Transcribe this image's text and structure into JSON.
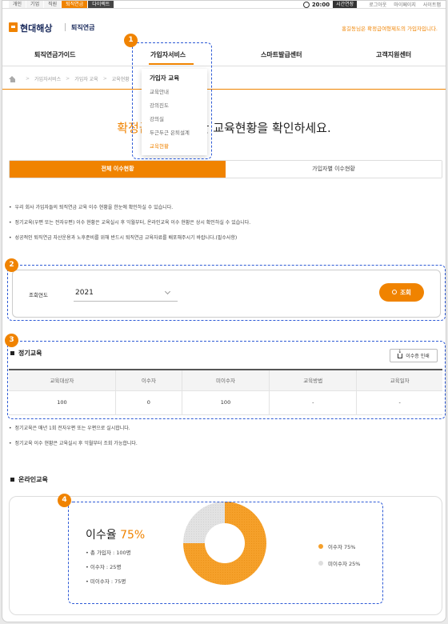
{
  "util": {
    "tabs": [
      "개인",
      "기업",
      "직원",
      "퇴직연금",
      "다이렉트"
    ],
    "time": "20:00",
    "extend": "시간연장",
    "links": [
      "로그아웃",
      "마이페이지",
      "사이트맵"
    ]
  },
  "header": {
    "logo": "현대해상",
    "logo_sub": "퇴직연금",
    "greeting": "홍길동님은 확정급여형제도의 가입자입니다."
  },
  "gnb": [
    "퇴직연금가이드",
    "가입자서비스",
    "스마트발급센터",
    "고객지원센터"
  ],
  "submenu": {
    "title": "가입자 교육",
    "items": [
      "교육안내",
      "강의진도",
      "강의실",
      "두근두근 은퇴설계",
      "교육현황"
    ]
  },
  "breadcrumb": [
    "가입자서비스",
    "가입자 교육",
    "교육현황"
  ],
  "headline": {
    "orange": "확정급여형",
    "rest": "에 대한 교육현황을 확인하세요."
  },
  "tabs": [
    "전체 이수현황",
    "가입자별 이수현황"
  ],
  "notes": [
    "우리 회사 가입자들의 퇴직연금 교육 이수 현황을 한눈에 확인하실 수 있습니다.",
    "정기교육(우편 또는 전자우편) 이수 현황은 교육실시 후 익월부터, 온라인교육 이수 현황은 상시 확인하실 수 있습니다.",
    "성공적인 퇴직연금 자산운용과 노후준비를 위해 반드시 퇴직연금 교육자료를 배포해주시기 바랍니다.(필수사항)"
  ],
  "search": {
    "label": "조회연도",
    "year": "2021",
    "button": "조회"
  },
  "regular": {
    "title": "정기교육",
    "print": "이수증 인쇄",
    "headers": [
      "교육대상자",
      "이수자",
      "미이수자",
      "교육방법",
      "교육일자"
    ],
    "row": [
      "100",
      "0",
      "100",
      "-",
      "-"
    ],
    "notes": [
      "정기교육은 매년 1회 전자우편 또는 우편으로 실시합니다.",
      "정기교육 이수 현황은 교육실시 후 익월부터 조회 가능합니다."
    ]
  },
  "online": {
    "title": "온라인교육",
    "rate_label": "이수율",
    "rate_value": "75%",
    "stats": [
      "총 가입자 : 100명",
      "이수자 : 25명",
      "미이수자 : 75명"
    ],
    "legend": [
      "이수자 75%",
      "미이수자 25%"
    ],
    "completed_fraction": 0.75,
    "colors": {
      "completed": "#f5a02a",
      "incomplete": "#dedede"
    }
  },
  "badges": [
    "1",
    "2",
    "3",
    "4"
  ]
}
